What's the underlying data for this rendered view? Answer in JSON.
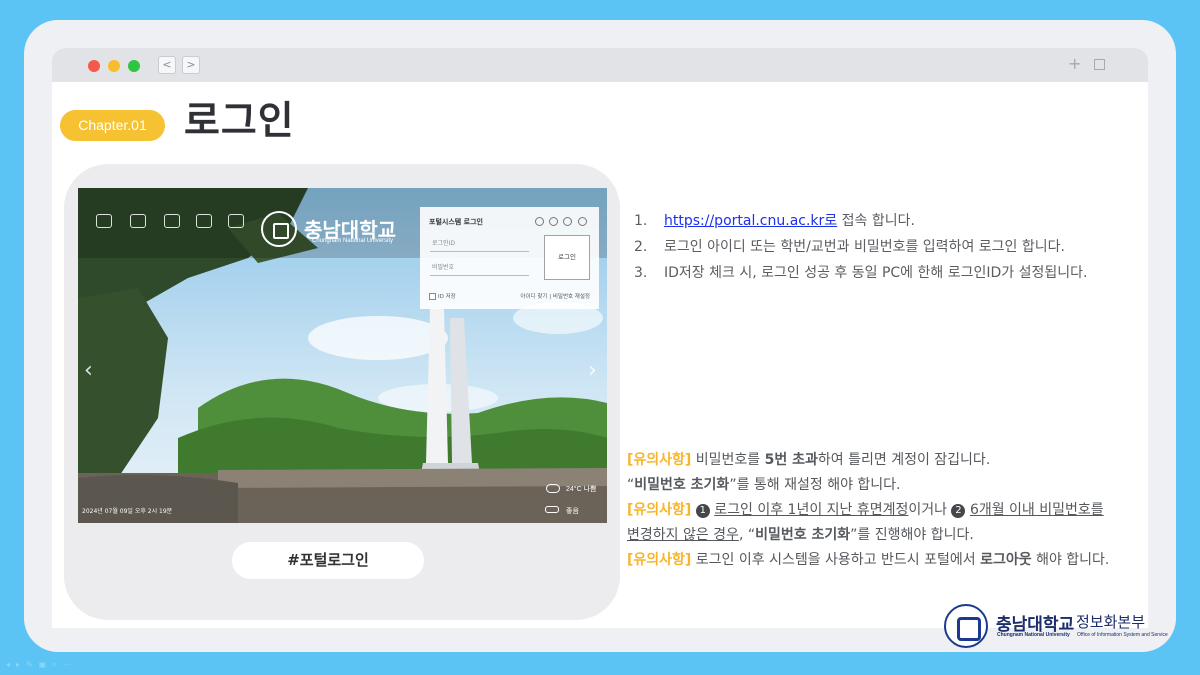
{
  "chapter": {
    "badge": "Chapter.01",
    "title": "로그인"
  },
  "browser": {
    "back_label": "<",
    "forward_label": ">",
    "new_tab_label": "+"
  },
  "screenshot": {
    "logo_ko": "충남대학교",
    "logo_en": "Chungnam National University",
    "login_panel": {
      "title": "포털시스템 로그인",
      "id_placeholder": "로그인ID",
      "pw_placeholder": "비밀번호",
      "login_button": "로그인",
      "id_save": "ID 저장",
      "links": "아이디 찾기 | 비밀번호 재설정"
    },
    "weather": "24°C 나쁨",
    "air_quality": "좋음",
    "datetime": "2024년 07월 09일 오후 2시 19분"
  },
  "hashtag": "#포털로그인",
  "steps": [
    {
      "num": "1.",
      "link": "https://portal.cnu.ac.kr로",
      "text": " 접속 합니다."
    },
    {
      "num": "2.",
      "text": "로그인 아이디 또는 학번/교번과 비밀번호를 입력하여 로그인 합니다."
    },
    {
      "num": "3.",
      "text": "ID저장 체크 시, 로그인 성공 후 동일 PC에 한해 로그인ID가 설정됩니다."
    }
  ],
  "notes": {
    "tag": "[유의사항]",
    "n1_a": " 비밀번호를 ",
    "n1_b": "5번 초과",
    "n1_c": "하여 틀리면 계정이 잠깁니다.",
    "n1_l2_a": "“",
    "n1_l2_b": "비밀번호 초기화",
    "n1_l2_c": "”를 통해 재설정 해야 합니다.",
    "n2_c1": "1",
    "n2_a": "로그인 이후 1년이 지난 휴면계정",
    "n2_b": "이거나",
    "n2_c2": "2",
    "n2_c": "6개월 이내 비밀번호를",
    "n2_l2_a": "변경하지 않은 경우",
    "n2_l2_b": ", “",
    "n2_l2_c": "비밀번호 초기화",
    "n2_l2_d": "”를 진행해야 합니다.",
    "n3_a": " 로그인 이후 시스템을 사용하고 반드시 포털에서 ",
    "n3_b": "로그아웃",
    "n3_c": " 해야 합니다."
  },
  "footer": {
    "univ": "충남대학교",
    "dept": "정보화본부",
    "univ_en": "Chungnam National University",
    "dept_en": "Office of Information System and Service"
  },
  "colors": {
    "accent": "#f7c231",
    "background": "#5bc4f5",
    "link": "#1d31e8",
    "brand": "#1b3a8f"
  }
}
